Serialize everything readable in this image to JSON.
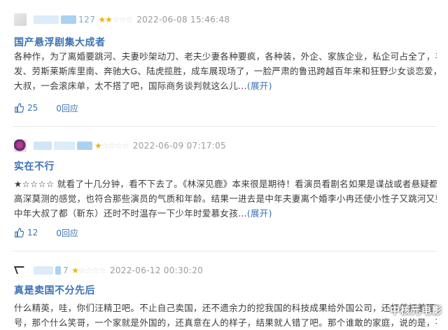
{
  "reviews": [
    {
      "user_tail": "127",
      "stars_on": "★★",
      "stars_off": "☆☆☆",
      "date": "2022-06-08 15:46:48",
      "title": "国产悬浮剧集大成者",
      "lines": [
        "各种作，为了离婚要跳河、夫妻吵架动刀、老夫少妻各种要疯，各种装，外企、家族企业，私企可占全了，丰田埃尔",
        "发、劳斯莱斯库里南、奔驰大G、陆虎揽胜，成车展现场了，一脸严肃的鲁迅跨越百年来和狂野少女谈恋爱，一会儿",
        "大叔，一会滚床单，太不搭了吧，国际商务谈判就这么儿..."
      ],
      "expand_label": "(展开)",
      "likes": "25",
      "replies": "0回应"
    },
    {
      "user_tail": "",
      "stars_on": "★",
      "stars_off": "☆☆☆☆",
      "date": "2022-06-09 07:17:05",
      "title": "实在不行",
      "lines": [
        "★☆☆☆☆ 就看了十几分钟，看不下去了。《林深见鹿》本来很是期待！看演员看剧名如果是谍战或者悬疑都应该是",
        "高深莫测的感觉，也符合那些演员的气质和年龄。结果一进去是中年夫妻离个婚李小冉还使小性子又跳河又要腾气的。",
        "中年大叔了都（靳东）还时不时温存一下少年时爱慕女孩..."
      ],
      "expand_label": "(展开)",
      "likes": "12",
      "replies": "0回应"
    },
    {
      "user_tail": "7",
      "stars_on": "★",
      "stars_off": "☆☆☆☆",
      "date": "2022-06-12 00:30:20",
      "title": "真是卖国不分先后",
      "lines": [
        "什么精英，哇，你们汪精卫吧。不止自己卖国，还不遗余力的挖我国的科技成果给外国公司，还打着打着理想主义的旗",
        "号，那个什么笑哥，一个家就是外国的，还真意在人的样子，结果就人错了吧。那个谁敢的家庭，说的是，不得你来"
      ],
      "expand_label": "",
      "likes": "",
      "replies": ""
    }
  ],
  "watermark": "中核元电影",
  "colors": {
    "link": "#3a72b5",
    "star": "#f0b400",
    "meta": "#9b9b9b"
  }
}
